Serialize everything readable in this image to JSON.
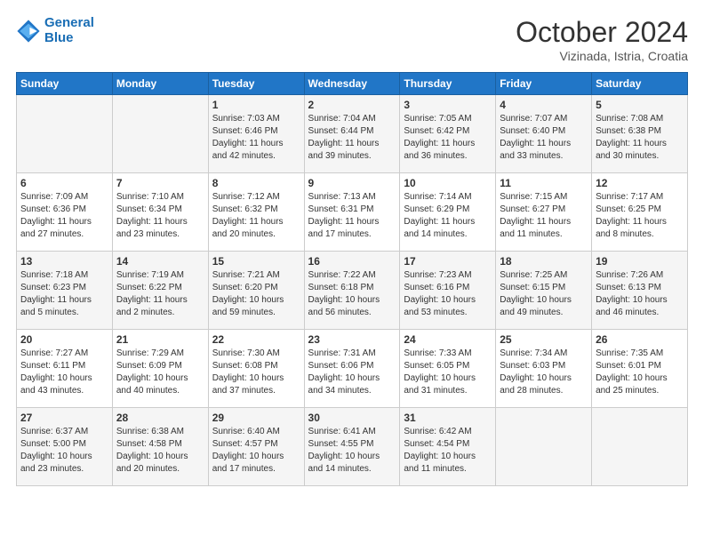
{
  "header": {
    "logo_line1": "General",
    "logo_line2": "Blue",
    "month": "October 2024",
    "location": "Vizinada, Istria, Croatia"
  },
  "weekdays": [
    "Sunday",
    "Monday",
    "Tuesday",
    "Wednesday",
    "Thursday",
    "Friday",
    "Saturday"
  ],
  "weeks": [
    [
      {
        "day": "",
        "sunrise": "",
        "sunset": "",
        "daylight": ""
      },
      {
        "day": "",
        "sunrise": "",
        "sunset": "",
        "daylight": ""
      },
      {
        "day": "1",
        "sunrise": "Sunrise: 7:03 AM",
        "sunset": "Sunset: 6:46 PM",
        "daylight": "Daylight: 11 hours and 42 minutes."
      },
      {
        "day": "2",
        "sunrise": "Sunrise: 7:04 AM",
        "sunset": "Sunset: 6:44 PM",
        "daylight": "Daylight: 11 hours and 39 minutes."
      },
      {
        "day": "3",
        "sunrise": "Sunrise: 7:05 AM",
        "sunset": "Sunset: 6:42 PM",
        "daylight": "Daylight: 11 hours and 36 minutes."
      },
      {
        "day": "4",
        "sunrise": "Sunrise: 7:07 AM",
        "sunset": "Sunset: 6:40 PM",
        "daylight": "Daylight: 11 hours and 33 minutes."
      },
      {
        "day": "5",
        "sunrise": "Sunrise: 7:08 AM",
        "sunset": "Sunset: 6:38 PM",
        "daylight": "Daylight: 11 hours and 30 minutes."
      }
    ],
    [
      {
        "day": "6",
        "sunrise": "Sunrise: 7:09 AM",
        "sunset": "Sunset: 6:36 PM",
        "daylight": "Daylight: 11 hours and 27 minutes."
      },
      {
        "day": "7",
        "sunrise": "Sunrise: 7:10 AM",
        "sunset": "Sunset: 6:34 PM",
        "daylight": "Daylight: 11 hours and 23 minutes."
      },
      {
        "day": "8",
        "sunrise": "Sunrise: 7:12 AM",
        "sunset": "Sunset: 6:32 PM",
        "daylight": "Daylight: 11 hours and 20 minutes."
      },
      {
        "day": "9",
        "sunrise": "Sunrise: 7:13 AM",
        "sunset": "Sunset: 6:31 PM",
        "daylight": "Daylight: 11 hours and 17 minutes."
      },
      {
        "day": "10",
        "sunrise": "Sunrise: 7:14 AM",
        "sunset": "Sunset: 6:29 PM",
        "daylight": "Daylight: 11 hours and 14 minutes."
      },
      {
        "day": "11",
        "sunrise": "Sunrise: 7:15 AM",
        "sunset": "Sunset: 6:27 PM",
        "daylight": "Daylight: 11 hours and 11 minutes."
      },
      {
        "day": "12",
        "sunrise": "Sunrise: 7:17 AM",
        "sunset": "Sunset: 6:25 PM",
        "daylight": "Daylight: 11 hours and 8 minutes."
      }
    ],
    [
      {
        "day": "13",
        "sunrise": "Sunrise: 7:18 AM",
        "sunset": "Sunset: 6:23 PM",
        "daylight": "Daylight: 11 hours and 5 minutes."
      },
      {
        "day": "14",
        "sunrise": "Sunrise: 7:19 AM",
        "sunset": "Sunset: 6:22 PM",
        "daylight": "Daylight: 11 hours and 2 minutes."
      },
      {
        "day": "15",
        "sunrise": "Sunrise: 7:21 AM",
        "sunset": "Sunset: 6:20 PM",
        "daylight": "Daylight: 10 hours and 59 minutes."
      },
      {
        "day": "16",
        "sunrise": "Sunrise: 7:22 AM",
        "sunset": "Sunset: 6:18 PM",
        "daylight": "Daylight: 10 hours and 56 minutes."
      },
      {
        "day": "17",
        "sunrise": "Sunrise: 7:23 AM",
        "sunset": "Sunset: 6:16 PM",
        "daylight": "Daylight: 10 hours and 53 minutes."
      },
      {
        "day": "18",
        "sunrise": "Sunrise: 7:25 AM",
        "sunset": "Sunset: 6:15 PM",
        "daylight": "Daylight: 10 hours and 49 minutes."
      },
      {
        "day": "19",
        "sunrise": "Sunrise: 7:26 AM",
        "sunset": "Sunset: 6:13 PM",
        "daylight": "Daylight: 10 hours and 46 minutes."
      }
    ],
    [
      {
        "day": "20",
        "sunrise": "Sunrise: 7:27 AM",
        "sunset": "Sunset: 6:11 PM",
        "daylight": "Daylight: 10 hours and 43 minutes."
      },
      {
        "day": "21",
        "sunrise": "Sunrise: 7:29 AM",
        "sunset": "Sunset: 6:09 PM",
        "daylight": "Daylight: 10 hours and 40 minutes."
      },
      {
        "day": "22",
        "sunrise": "Sunrise: 7:30 AM",
        "sunset": "Sunset: 6:08 PM",
        "daylight": "Daylight: 10 hours and 37 minutes."
      },
      {
        "day": "23",
        "sunrise": "Sunrise: 7:31 AM",
        "sunset": "Sunset: 6:06 PM",
        "daylight": "Daylight: 10 hours and 34 minutes."
      },
      {
        "day": "24",
        "sunrise": "Sunrise: 7:33 AM",
        "sunset": "Sunset: 6:05 PM",
        "daylight": "Daylight: 10 hours and 31 minutes."
      },
      {
        "day": "25",
        "sunrise": "Sunrise: 7:34 AM",
        "sunset": "Sunset: 6:03 PM",
        "daylight": "Daylight: 10 hours and 28 minutes."
      },
      {
        "day": "26",
        "sunrise": "Sunrise: 7:35 AM",
        "sunset": "Sunset: 6:01 PM",
        "daylight": "Daylight: 10 hours and 25 minutes."
      }
    ],
    [
      {
        "day": "27",
        "sunrise": "Sunrise: 6:37 AM",
        "sunset": "Sunset: 5:00 PM",
        "daylight": "Daylight: 10 hours and 23 minutes."
      },
      {
        "day": "28",
        "sunrise": "Sunrise: 6:38 AM",
        "sunset": "Sunset: 4:58 PM",
        "daylight": "Daylight: 10 hours and 20 minutes."
      },
      {
        "day": "29",
        "sunrise": "Sunrise: 6:40 AM",
        "sunset": "Sunset: 4:57 PM",
        "daylight": "Daylight: 10 hours and 17 minutes."
      },
      {
        "day": "30",
        "sunrise": "Sunrise: 6:41 AM",
        "sunset": "Sunset: 4:55 PM",
        "daylight": "Daylight: 10 hours and 14 minutes."
      },
      {
        "day": "31",
        "sunrise": "Sunrise: 6:42 AM",
        "sunset": "Sunset: 4:54 PM",
        "daylight": "Daylight: 10 hours and 11 minutes."
      },
      {
        "day": "",
        "sunrise": "",
        "sunset": "",
        "daylight": ""
      },
      {
        "day": "",
        "sunrise": "",
        "sunset": "",
        "daylight": ""
      }
    ]
  ]
}
